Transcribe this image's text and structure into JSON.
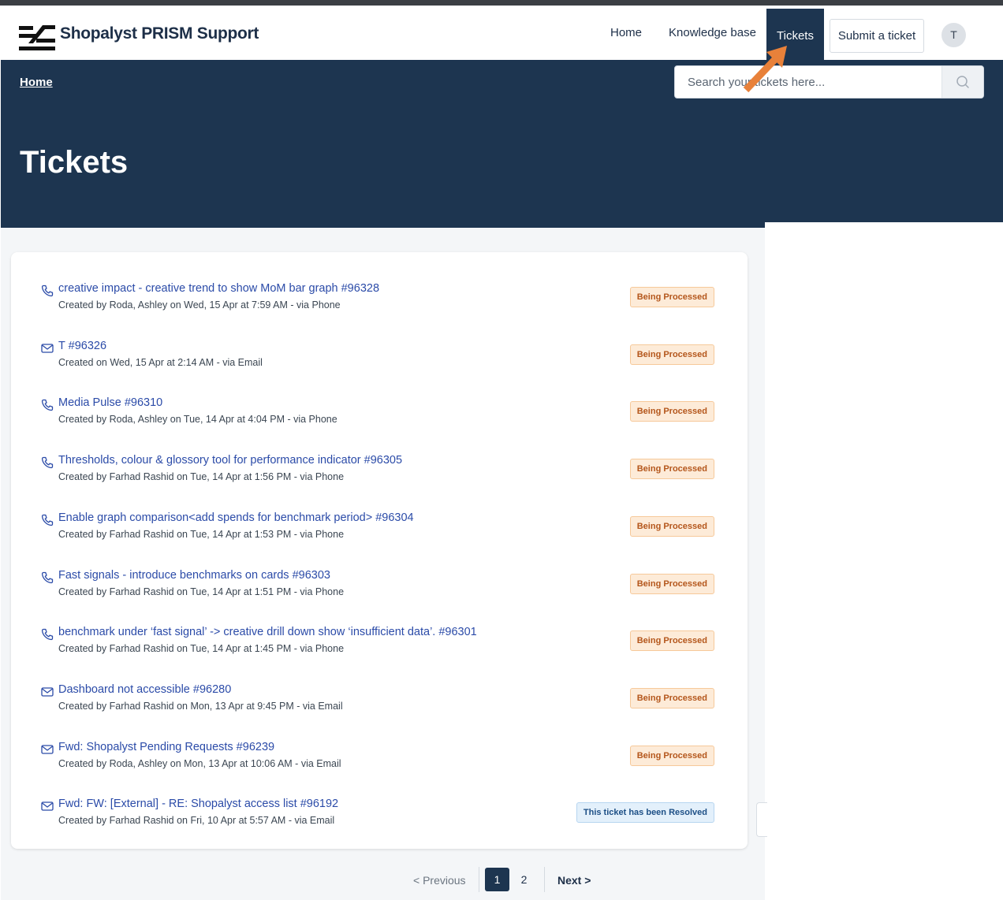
{
  "header": {
    "brand": "Shopalyst PRISM Support",
    "nav": {
      "home": "Home",
      "knowledge_base": "Knowledge base",
      "tickets": "Tickets",
      "submit": "Submit a ticket"
    },
    "avatar_initial": "T"
  },
  "banner": {
    "breadcrumb": "Home",
    "search_placeholder": "Search your tickets here...",
    "title": "Tickets"
  },
  "tickets": [
    {
      "icon": "phone-icon",
      "title": "creative impact - creative trend to show MoM bar graph #96328",
      "meta": "Created by Roda, Ashley on Wed, 15 Apr at 7:59 AM - via Phone",
      "status": "Being Processed"
    },
    {
      "icon": "email-icon",
      "title": "T #96326",
      "meta": "Created on Wed, 15 Apr at 2:14 AM - via Email",
      "status": "Being Processed"
    },
    {
      "icon": "phone-icon",
      "title": "Media Pulse #96310",
      "meta": "Created by Roda, Ashley on Tue, 14 Apr at 4:04 PM - via Phone",
      "status": "Being Processed"
    },
    {
      "icon": "phone-icon",
      "title": "Thresholds, colour & glossory tool for performance indicator #96305",
      "meta": "Created by Farhad Rashid on Tue, 14 Apr at 1:56 PM - via Phone",
      "status": "Being Processed"
    },
    {
      "icon": "phone-icon",
      "title": "Enable graph comparison<add spends for benchmark period> #96304",
      "meta": "Created by Farhad Rashid on Tue, 14 Apr at 1:53 PM - via Phone",
      "status": "Being Processed"
    },
    {
      "icon": "phone-icon",
      "title": "Fast signals - introduce benchmarks on cards #96303",
      "meta": "Created by Farhad Rashid on Tue, 14 Apr at 1:51 PM - via Phone",
      "status": "Being Processed"
    },
    {
      "icon": "phone-icon",
      "title": "benchmark under ‘fast signal’ -> creative drill down show ‘insufficient data’. #96301",
      "meta": "Created by Farhad Rashid on Tue, 14 Apr at 1:45 PM - via Phone",
      "status": "Being Processed"
    },
    {
      "icon": "email-icon",
      "title": "Dashboard not accessible #96280",
      "meta": "Created by Farhad Rashid on Mon, 13 Apr at 9:45 PM - via Email",
      "status": "Being Processed"
    },
    {
      "icon": "email-icon",
      "title": "Fwd: Shopalyst Pending Requests #96239",
      "meta": "Created by Roda, Ashley on Mon, 13 Apr at 10:06 AM - via Email",
      "status": "Being Processed"
    },
    {
      "icon": "email-icon",
      "title": "Fwd: FW: [External] - RE: Shopalyst access list #96192",
      "meta": "Created by Farhad Rashid on Fri, 10 Apr at 5:57 AM - via Email",
      "status": "This ticket has been Resolved"
    }
  ],
  "pagination": {
    "previous": "< Previous",
    "pages": [
      "1",
      "2"
    ],
    "current": "1",
    "next": "Next >"
  },
  "colors": {
    "brand_navy": "#1d3550",
    "link_blue": "#2b4ba8",
    "processing_text": "#b4561b",
    "processing_bg": "#fdebd8",
    "resolved_text": "#1d4f86",
    "resolved_bg": "#e3f0fb",
    "annotation_arrow": "#e8813a"
  }
}
